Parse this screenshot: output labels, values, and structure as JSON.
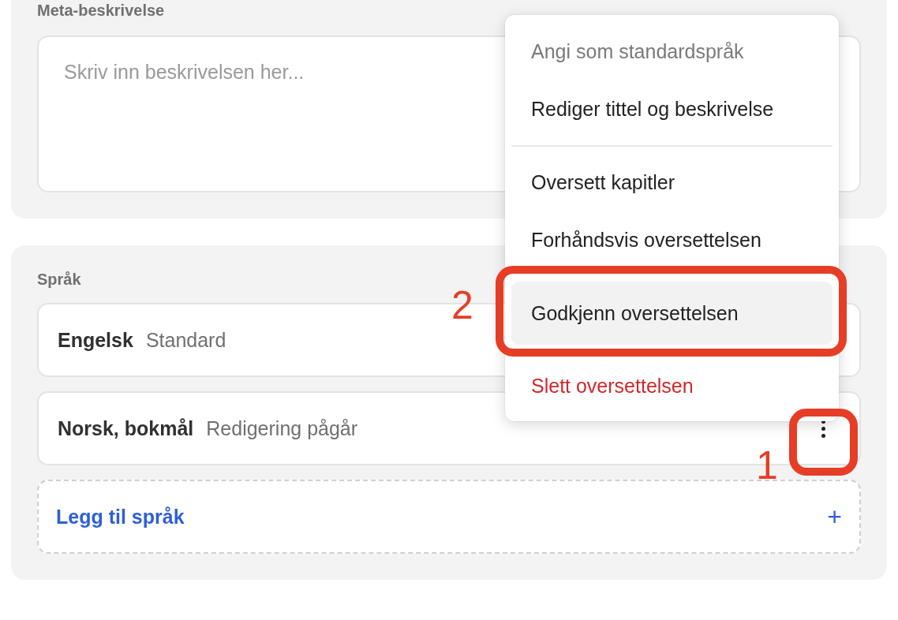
{
  "description_card": {
    "label": "Meta-beskrivelse",
    "textarea": {
      "placeholder": "Skriv inn beskrivelsen her..."
    }
  },
  "languages_card": {
    "label": "Språk",
    "rows": [
      {
        "name": "Engelsk",
        "status": "Standard",
        "has_menu": false
      },
      {
        "name": "Norsk, bokmål",
        "status": "Redigering pågår",
        "has_menu": true
      }
    ],
    "add_button": {
      "label": "Legg til språk",
      "icon": "+"
    }
  },
  "context_menu": {
    "groups": [
      [
        {
          "label": "Angi som standardspråk",
          "kind": "normal",
          "disabled": true,
          "highlighted": false
        },
        {
          "label": "Rediger tittel og beskrivelse",
          "kind": "normal",
          "disabled": false,
          "highlighted": false
        }
      ],
      [
        {
          "label": "Oversett kapitler",
          "kind": "normal",
          "disabled": false,
          "highlighted": false
        },
        {
          "label": "Forhåndsvis oversettelsen",
          "kind": "normal",
          "disabled": false,
          "highlighted": false
        },
        {
          "label": "Godkjenn oversettelsen",
          "kind": "normal",
          "disabled": false,
          "highlighted": true
        },
        {
          "label": "Slett oversettelsen",
          "kind": "danger",
          "disabled": false,
          "highlighted": false
        }
      ]
    ]
  },
  "annotations": [
    {
      "number": "1"
    },
    {
      "number": "2"
    }
  ]
}
